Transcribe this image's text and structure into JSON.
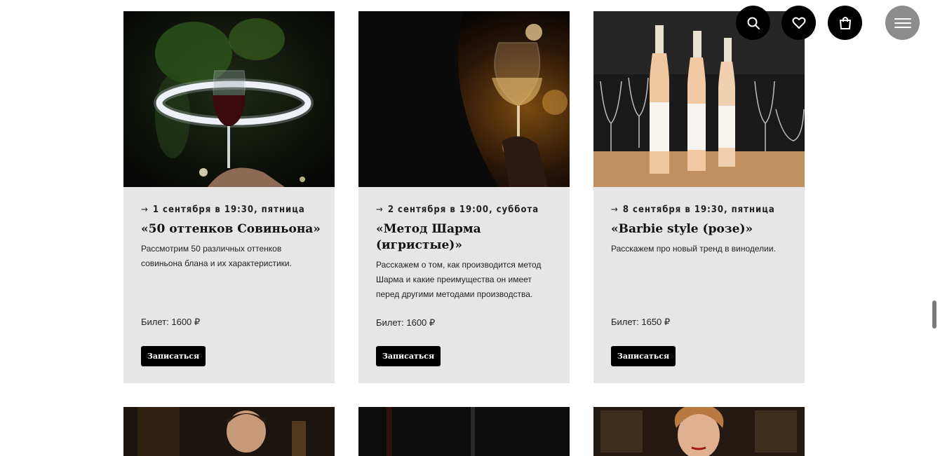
{
  "header": {
    "icons": [
      "search-icon",
      "heart-icon",
      "bag-icon",
      "menu-icon"
    ]
  },
  "events": [
    {
      "date": "1 сентября в 19:30, пятница",
      "title": "«50 оттенков Совиньона»",
      "description": "Рассмотрим 50 различных оттенков совиньона блана и их характеристики.",
      "price": "Билет: 1600 ₽",
      "button": "Записаться"
    },
    {
      "date": "2 сентября в 19:00, суббота",
      "title": "«Метод Шарма (игристые)»",
      "description": "Расскажем о том, как производится метод Шарма и какие преимущества он имеет перед другими методами производства.",
      "price": "Билет: 1600 ₽",
      "button": "Записаться"
    },
    {
      "date": "8 сентября в 19:30, пятница",
      "title": "«Barbie style (розе)»",
      "description": "Расскажем про новый тренд в виноделии.",
      "price": "Билет: 1650 ₽",
      "button": "Записаться"
    }
  ],
  "colors": {
    "card_bg": "#e6e6e6",
    "button_bg": "#000000",
    "button_text": "#ffffff",
    "menu_button": "#8c8c8c"
  }
}
